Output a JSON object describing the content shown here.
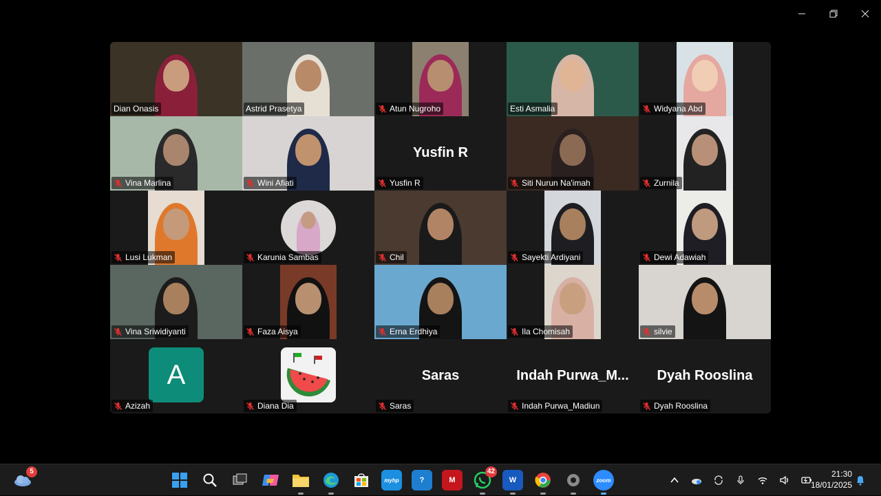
{
  "window": {
    "controls": [
      "minimize-icon",
      "restore-icon",
      "close-icon"
    ]
  },
  "meeting": {
    "participants": [
      {
        "name": "Dian Onasis",
        "muted": false,
        "kind": "video",
        "bg": "#3a3326",
        "skin": "#c89c7c",
        "scarf": "#8a1f3a"
      },
      {
        "name": "Astrid Prasetya",
        "muted": false,
        "kind": "video",
        "active": true,
        "bg": "#6b6f6a",
        "skin": "#b88a68",
        "scarf": "#e6e0d4"
      },
      {
        "name": "Atun Nugroho",
        "muted": true,
        "kind": "video-narrow",
        "bg": "#8c8070",
        "skin": "#b88e70",
        "scarf": "#9c2a58"
      },
      {
        "name": "Esti Asmalia",
        "muted": false,
        "kind": "video",
        "bg": "#2c5a4a",
        "skin": "#e0b596",
        "scarf": "#d6b6a6"
      },
      {
        "name": "Widyana Abd",
        "muted": true,
        "kind": "video-narrow",
        "bg": "#d8e2e6",
        "skin": "#f0cdb4",
        "scarf": "#e4a8a0"
      },
      {
        "name": "Vina Marlina",
        "muted": true,
        "kind": "video",
        "bg": "#a8b8a8",
        "skin": "#a9856e",
        "scarf": "#2a2a2a"
      },
      {
        "name": "Wini Afiati",
        "muted": true,
        "kind": "video",
        "bg": "#d8d4d4",
        "skin": "#c0926e",
        "scarf": "#1e2a48"
      },
      {
        "name": "Yusfin R",
        "muted": true,
        "kind": "name",
        "display": "Yusfin R"
      },
      {
        "name": "Siti Nurun Na'imah",
        "muted": true,
        "kind": "video",
        "bg": "#3a2a22",
        "skin": "#8a6a52",
        "scarf": "#2a2020"
      },
      {
        "name": "Zurnila",
        "muted": true,
        "kind": "video-narrow",
        "bg": "#e8e8ea",
        "skin": "#b89078",
        "scarf": "#222222"
      },
      {
        "name": "Lusi Lukman",
        "muted": true,
        "kind": "video-narrow",
        "bg": "#e6dcd2",
        "skin": "#c49a7a",
        "scarf": "#e0782c"
      },
      {
        "name": "Karunia Sambas",
        "muted": true,
        "kind": "photo",
        "bg": "#dcd8d8",
        "skin": "#c49c84",
        "scarf": "#d8a8c8"
      },
      {
        "name": "Chil",
        "muted": true,
        "kind": "video",
        "bg": "#4a3a30",
        "skin": "#b08464",
        "scarf": "#1a1a1a"
      },
      {
        "name": "Sayekti Ardiyani",
        "muted": true,
        "kind": "video-narrow",
        "bg": "#d4d8dc",
        "skin": "#a8805e",
        "scarf": "#1e1e22"
      },
      {
        "name": "Dewi Adawiah",
        "muted": true,
        "kind": "video-narrow",
        "bg": "#ecece8",
        "skin": "#c09a7e",
        "scarf": "#1e1e24"
      },
      {
        "name": "Vina Sriwidiyanti",
        "muted": true,
        "kind": "video",
        "bg": "#5a6660",
        "skin": "#a8805e",
        "scarf": "#1c1c1c"
      },
      {
        "name": "Faza Aisya",
        "muted": true,
        "kind": "video-narrow",
        "bg": "#7a3a28",
        "skin": "#b89070",
        "scarf": "#111111"
      },
      {
        "name": "Erna Erdhiya",
        "muted": true,
        "kind": "video",
        "bg": "#6aa8d0",
        "skin": "#a8805e",
        "scarf": "#141414"
      },
      {
        "name": "Ila Chomisah",
        "muted": true,
        "kind": "video-narrow",
        "bg": "#dcd6cc",
        "skin": "#c8a080",
        "scarf": "#d8b0a4"
      },
      {
        "name": "silvie",
        "muted": true,
        "kind": "video",
        "bg": "#d8d4d0",
        "skin": "#b88c6a",
        "scarf": "#141414"
      },
      {
        "name": "Azizah",
        "muted": true,
        "kind": "letter",
        "letter": "A"
      },
      {
        "name": "Diana Dia",
        "muted": true,
        "kind": "watermelon"
      },
      {
        "name": "Saras",
        "muted": true,
        "kind": "name",
        "display": "Saras"
      },
      {
        "name": "Indah Purwa_Madiun",
        "muted": true,
        "kind": "name",
        "display": "Indah  Purwa_M..."
      },
      {
        "name": "Dyah Rooslina",
        "muted": true,
        "kind": "name",
        "display": "Dyah Rooslina"
      }
    ]
  },
  "taskbar": {
    "weather_badge": "5",
    "apps": [
      {
        "name": "start",
        "icon": "windows-icon",
        "color": "#3aa0f0"
      },
      {
        "name": "search",
        "icon": "search-icon",
        "color": "transparent"
      },
      {
        "name": "task-view",
        "icon": "task-view-icon",
        "color": "transparent"
      },
      {
        "name": "copilot",
        "icon": "copilot-icon",
        "color": "#8a5cf0"
      },
      {
        "name": "file-explorer",
        "icon": "folder-icon",
        "color": "#f2c43a"
      },
      {
        "name": "edge",
        "icon": "edge-icon",
        "color": "#1e9ad6"
      },
      {
        "name": "store",
        "icon": "store-icon",
        "color": "#f0f0f0"
      },
      {
        "name": "myhp",
        "icon": "myhp-icon",
        "color": "#1d8fe0",
        "label": "myhp"
      },
      {
        "name": "help",
        "icon": "help-icon",
        "color": "#1e7fd0",
        "label": "?"
      },
      {
        "name": "mcafee",
        "icon": "mcafee-icon",
        "color": "#c4161c",
        "label": "M"
      },
      {
        "name": "whatsapp",
        "icon": "whatsapp-icon",
        "color": "#25d366",
        "badge": "42"
      },
      {
        "name": "word",
        "icon": "word-icon",
        "color": "#185abd",
        "label": "W"
      },
      {
        "name": "chrome",
        "icon": "chrome-icon",
        "color": "#e8453c"
      },
      {
        "name": "settings",
        "icon": "settings-icon",
        "color": "#6a6a6a"
      },
      {
        "name": "zoom",
        "icon": "zoom-icon",
        "color": "#2d8cff",
        "label": "zoom"
      }
    ],
    "tray": [
      "chevron-up-icon",
      "onedrive-icon",
      "sync-icon",
      "microphone-icon",
      "wifi-icon",
      "volume-icon",
      "battery-icon"
    ],
    "time": "21:30",
    "date": "18/01/2025"
  }
}
